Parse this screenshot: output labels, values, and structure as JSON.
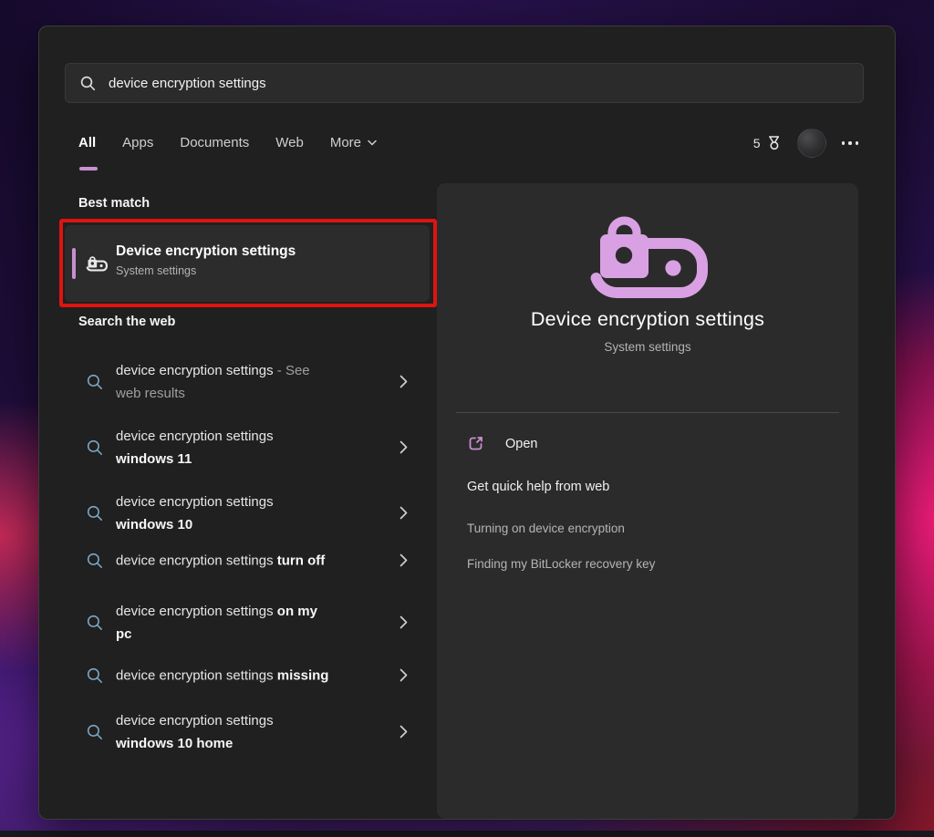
{
  "search_bar": {
    "query": "device encryption settings"
  },
  "tabs": {
    "items": [
      {
        "label": "All",
        "active": true
      },
      {
        "label": "Apps",
        "active": false
      },
      {
        "label": "Documents",
        "active": false
      },
      {
        "label": "Web",
        "active": false
      },
      {
        "label": "More",
        "active": false,
        "chevron": true
      }
    ],
    "rewards_count": "5"
  },
  "best_match": {
    "header": "Best match",
    "result": {
      "title": "Device encryption settings",
      "subtitle": "System settings"
    }
  },
  "web_search": {
    "header": "Search the web",
    "items": [
      {
        "l1": "device encryption settings",
        "l1x": " - See",
        "l2": "web results"
      },
      {
        "l1": "device encryption settings",
        "l1x": "",
        "l2": "windows 11"
      },
      {
        "l1": "device encryption settings",
        "l1x": "",
        "l2": "windows 10"
      },
      {
        "l1": "device encryption settings",
        "l1x": " turn off",
        "l2": ""
      },
      {
        "l1": "device encryption settings",
        "l1x": " on my",
        "l2": "pc"
      },
      {
        "l1": "device encryption settings",
        "l1x": " missing",
        "l2": ""
      },
      {
        "l1": "device encryption settings",
        "l1x": "",
        "l2": "windows 10 home"
      }
    ]
  },
  "preview": {
    "title": "Device encryption settings",
    "subtitle": "System settings",
    "open_label": "Open",
    "quick_help_header": "Get quick help from web",
    "links": [
      "Turning on device encryption",
      "Finding my BitLocker recovery key"
    ]
  },
  "colors": {
    "accent_purple": "#c790d2",
    "icon_purple": "#d9a1e3",
    "annotation_red": "#de1410",
    "panel_bg": "#2b2b2b",
    "window_bg": "#202020",
    "list_icon_blue": "#7ba6c4"
  }
}
